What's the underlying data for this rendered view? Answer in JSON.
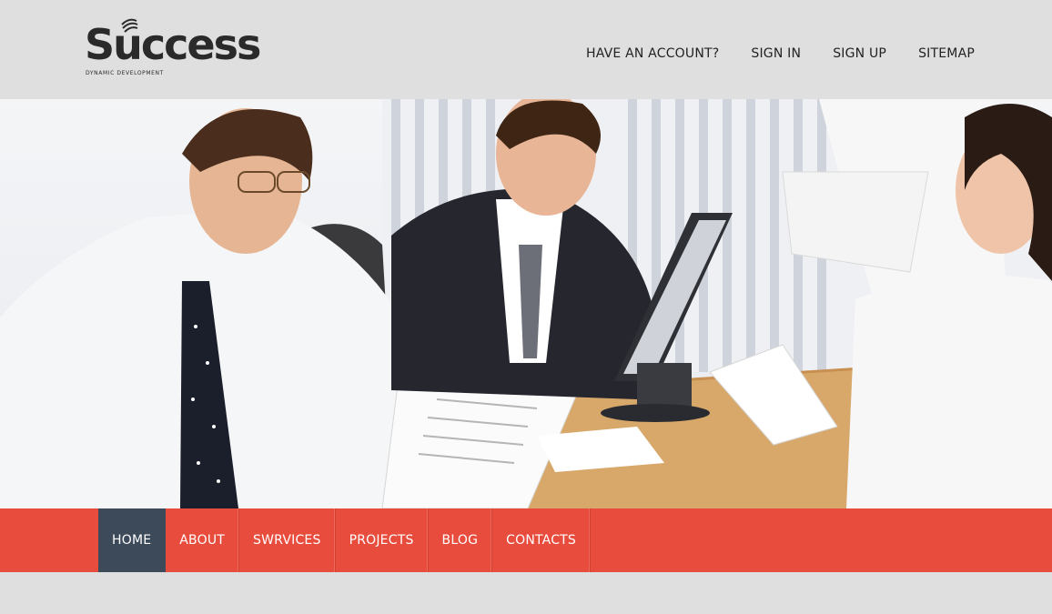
{
  "logo": {
    "word": "Success",
    "tagline": "DYNAMIC DEVELOPMENT"
  },
  "topnav": [
    {
      "label": "HAVE AN ACCOUNT?"
    },
    {
      "label": "SIGN IN"
    },
    {
      "label": "SIGN UP"
    },
    {
      "label": "SITEMAP"
    }
  ],
  "menu": [
    {
      "label": "HOME",
      "active": true
    },
    {
      "label": "ABOUT"
    },
    {
      "label": "SWRVICES"
    },
    {
      "label": "PROJECTS"
    },
    {
      "label": "BLOG"
    },
    {
      "label": "CONTACTS"
    }
  ],
  "colors": {
    "menu_bg": "#e84c3d",
    "menu_active": "#3c4a5a",
    "page_bg": "#dfdfdf"
  }
}
